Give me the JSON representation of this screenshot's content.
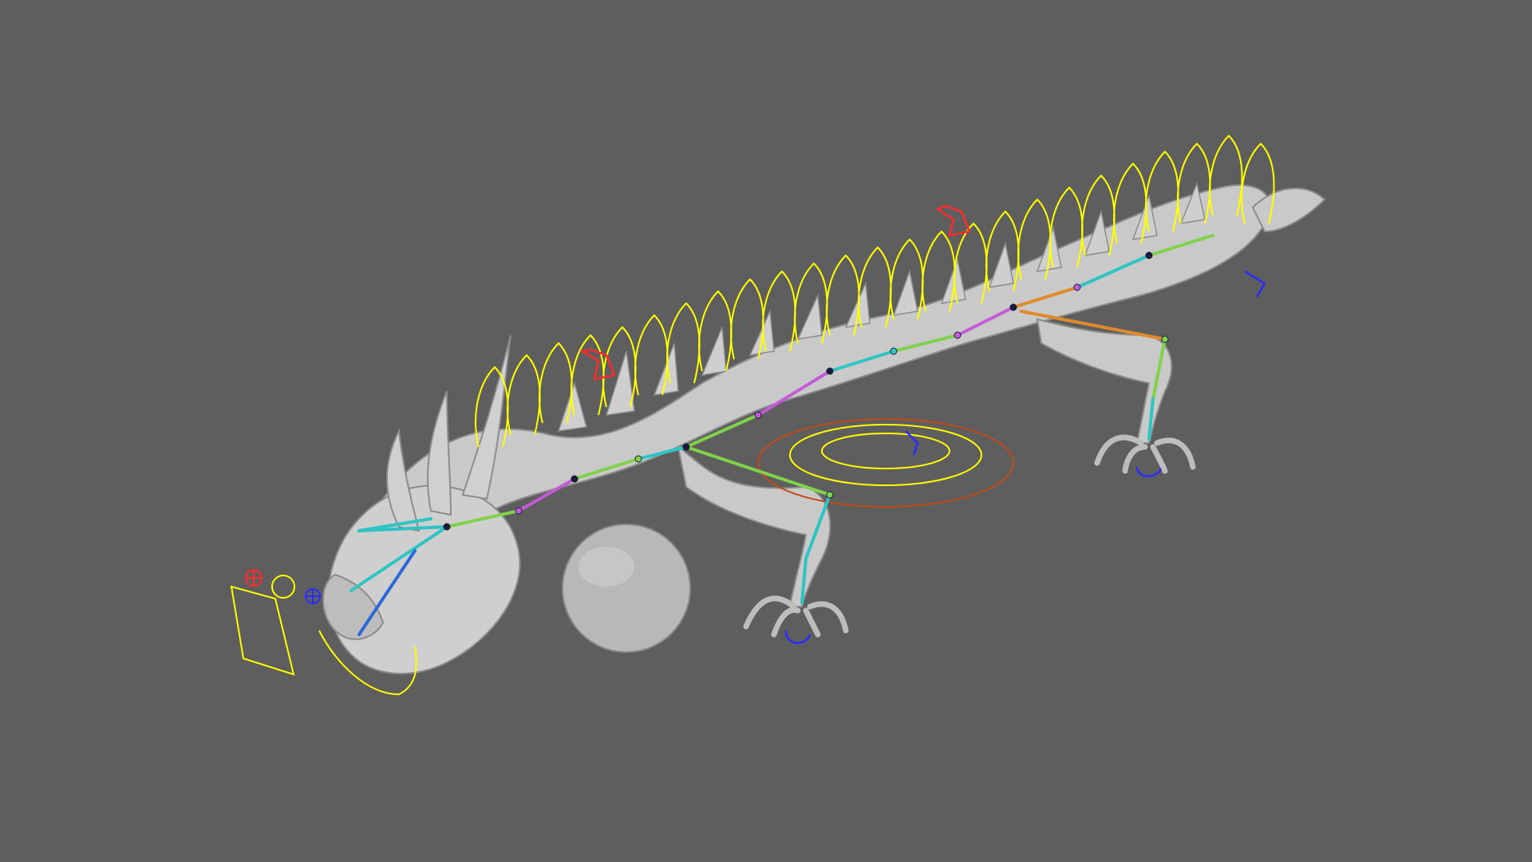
{
  "scene": {
    "background_color": "#5e5e5e",
    "model": {
      "subject": "dragon",
      "body_color": "#c9c9c9",
      "body_shade_color": "#9a9a9a",
      "sphere_color": "#b8b8b8"
    },
    "rig_colors": {
      "fk_curve_control": "#ffff00",
      "ik_control": "#ff2a2a",
      "pole_vector_control": "#2a2aff",
      "root_control": "#c04a1a",
      "joint_chain": [
        "#2ec4c4",
        "#7fd24a",
        "#c45ad8",
        "#1a1a3a",
        "#e08a2a"
      ]
    }
  }
}
